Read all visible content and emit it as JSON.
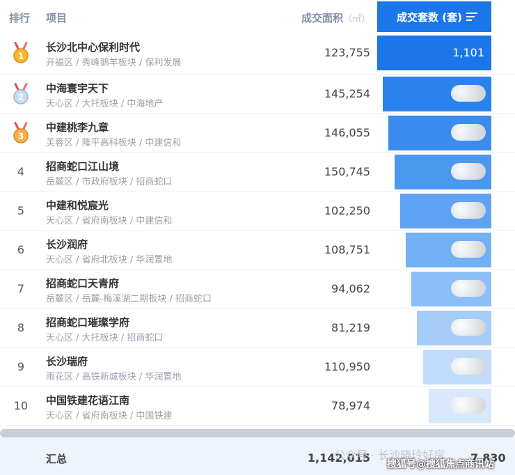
{
  "header": {
    "rank": "排行",
    "project": "项目",
    "area": "成交面积",
    "area_unit": "（㎡）",
    "count": "成交套数 (套)"
  },
  "colors": {
    "accent": "#1b77e9",
    "bars": [
      "#1b77e9",
      "#2a82ec",
      "#3a8cef",
      "#4b98f1",
      "#5ea3f3",
      "#72b0f5",
      "#8cbff7",
      "#a6cdf9",
      "#c1dcfb",
      "#d9e9fd"
    ]
  },
  "rows": [
    {
      "rank": "1",
      "medal": "gold",
      "name": "长沙北中心保利时代",
      "district": "开福区",
      "block": "秀峰鹅羊板块",
      "developer": "保利发展",
      "area": "123,755",
      "count": "1,101",
      "count_fraction": 1.0
    },
    {
      "rank": "2",
      "medal": "silver",
      "name": "中海寰宇天下",
      "district": "天心区",
      "block": "大托板块",
      "developer": "中海地产",
      "area": "145,254",
      "count": "",
      "count_fraction": 0.95
    },
    {
      "rank": "3",
      "medal": "bronze",
      "name": "中建桃李九章",
      "district": "芙蓉区",
      "block": "隆平高科板块",
      "developer": "中建信和",
      "area": "146,055",
      "count": "",
      "count_fraction": 0.9
    },
    {
      "rank": "4",
      "medal": "",
      "name": "招商蛇口江山境",
      "district": "岳麓区",
      "block": "市政府板块",
      "developer": "招商蛇口",
      "area": "150,745",
      "count": "",
      "count_fraction": 0.85
    },
    {
      "rank": "5",
      "medal": "",
      "name": "中建和悦宸光",
      "district": "天心区",
      "block": "省府南板块",
      "developer": "中建信和",
      "area": "102,250",
      "count": "",
      "count_fraction": 0.8
    },
    {
      "rank": "6",
      "medal": "",
      "name": "长沙润府",
      "district": "天心区",
      "block": "省府北板块",
      "developer": "华润置地",
      "area": "108,751",
      "count": "",
      "count_fraction": 0.75
    },
    {
      "rank": "7",
      "medal": "",
      "name": "招商蛇口天青府",
      "district": "岳麓区",
      "block": "岳麓-梅溪湖二期板块",
      "developer": "招商蛇口",
      "area": "94,062",
      "count": "",
      "count_fraction": 0.7
    },
    {
      "rank": "8",
      "medal": "",
      "name": "招商蛇口璀璨学府",
      "district": "天心区",
      "block": "大托板块",
      "developer": "招商蛇口",
      "area": "81,219",
      "count": "",
      "count_fraction": 0.65
    },
    {
      "rank": "9",
      "medal": "",
      "name": "长沙瑞府",
      "district": "雨花区",
      "block": "高铁新城板块",
      "developer": "华润置地",
      "area": "110,950",
      "count": "",
      "count_fraction": 0.6
    },
    {
      "rank": "10",
      "medal": "",
      "name": "中国铁建花语江南",
      "district": "天心区",
      "block": "省府南板块",
      "developer": "中国铁建",
      "area": "78,974",
      "count": "",
      "count_fraction": 0.55
    }
  ],
  "footer": {
    "label": "汇总",
    "area_total": "1,142,015",
    "count_total": "7,830",
    "watermark_1": "公众号 · 长沙晓玲好房",
    "watermark_2": "搜狐号@搜狐焦点商讯站"
  }
}
